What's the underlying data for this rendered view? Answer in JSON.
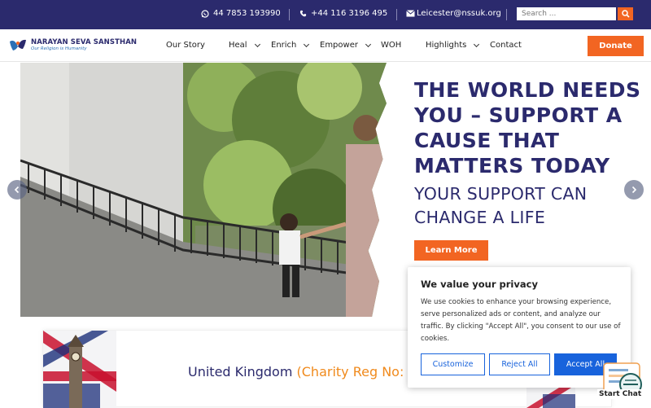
{
  "topbar": {
    "whatsapp": "44 7853 193990",
    "phone": "+44 116 3196 495",
    "email": "Leicester@nssuk.org",
    "search_placeholder": "Search ..."
  },
  "brand": {
    "name": "NARAYAN SEVA SANSTHAN",
    "tagline": "Our Religion is Humanity"
  },
  "nav": {
    "items": [
      {
        "label": "Our Story",
        "has_caret": false
      },
      {
        "label": "Heal",
        "has_caret": true
      },
      {
        "label": "Enrich",
        "has_caret": true
      },
      {
        "label": "Empower",
        "has_caret": true
      },
      {
        "label": "WOH",
        "has_caret": false
      },
      {
        "label": "Highlights",
        "has_caret": true
      },
      {
        "label": "Contact",
        "has_caret": false
      }
    ],
    "donate_label": "Donate"
  },
  "hero": {
    "headline": "THE WORLD NEEDS YOU – SUPPORT A CAUSE THAT MATTERS TODAY",
    "subline": "YOUR SUPPORT CAN CHANGE A LIFE",
    "cta_label": "Learn More"
  },
  "section": {
    "country": "United Kingdom",
    "charity_reg": "(Charity Reg No: 1"
  },
  "cookie": {
    "title": "We value your privacy",
    "body": "We use cookies to enhance your browsing experience, serve personalized ads or content, and analyze our traffic. By clicking \"Accept All\", you consent to our use of cookies.",
    "customize_label": "Customize",
    "reject_label": "Reject All",
    "accept_label": "Accept All"
  },
  "chat": {
    "label": "Start Chat"
  },
  "colors": {
    "navy": "#2b2a6d",
    "orange": "#f26522",
    "cookie_blue": "#1863dc"
  }
}
